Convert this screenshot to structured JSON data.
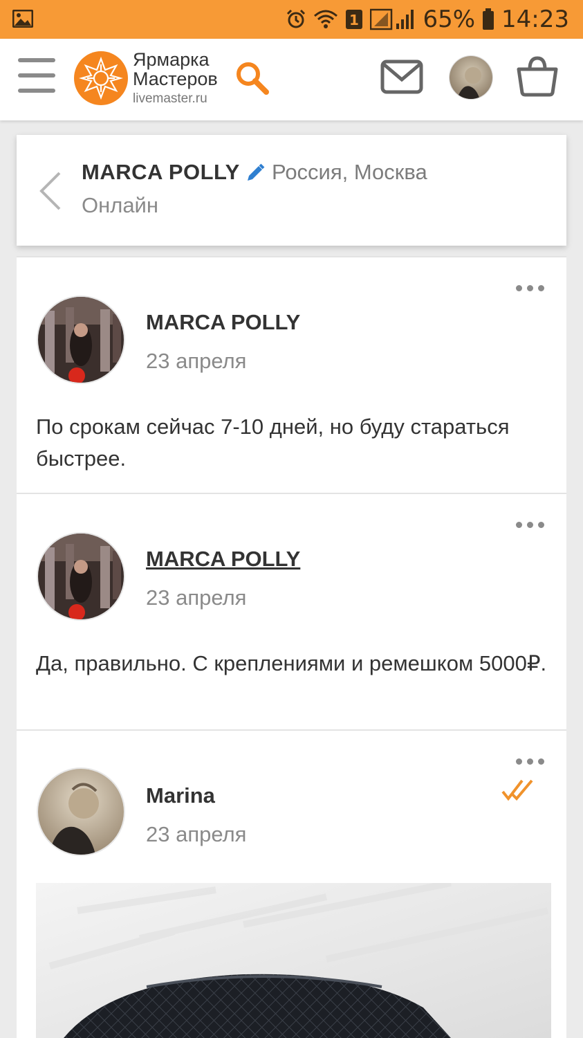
{
  "status_bar": {
    "battery_percent": "65%",
    "time": "14:23",
    "sim_badge": "1",
    "bar_color": "#f79a36",
    "icons": [
      "gallery-icon",
      "alarm-icon",
      "wifi-icon",
      "sim-icon",
      "signal-icon",
      "battery-icon"
    ]
  },
  "header": {
    "logo_line1": "Ярмарка",
    "logo_line2": "Мастеров",
    "logo_domain": "livemaster.ru",
    "brand_color": "#f5861f"
  },
  "chat": {
    "contact_name": "MARCA POLLY",
    "location": "Россия, Москва",
    "status": "Онлайн"
  },
  "messages": [
    {
      "author": "MARCA POLLY",
      "date": "23 апреля",
      "text": "По срокам сейчас 7-10 дней, но буду стараться быстрее.",
      "author_underlined": false
    },
    {
      "author": "MARCA POLLY",
      "date": "23 апреля",
      "text": "Да, правильно. С креплениями и ремешком 5000₽.",
      "author_underlined": true
    },
    {
      "author": "Marina",
      "date": "23 апреля",
      "read_status": "read",
      "has_photo": true
    }
  ]
}
